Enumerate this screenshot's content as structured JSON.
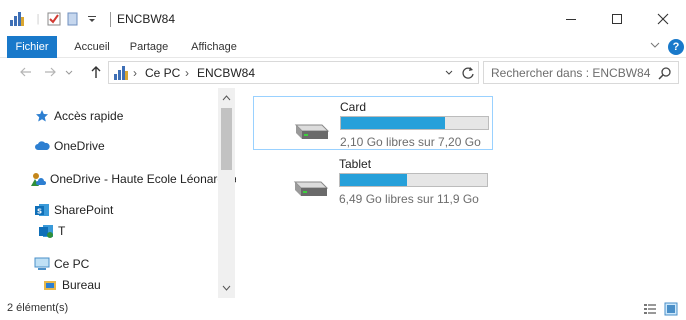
{
  "window": {
    "title": "ENCBW84",
    "controls": [
      "minimize",
      "maximize",
      "close"
    ]
  },
  "ribbon": {
    "tabs": [
      {
        "label": "Fichier",
        "active": true
      },
      {
        "label": "Accueil"
      },
      {
        "label": "Partage"
      },
      {
        "label": "Affichage"
      }
    ]
  },
  "address": {
    "segments": [
      "Ce PC",
      "ENCBW84"
    ],
    "search_placeholder": "Rechercher dans : ENCBW84"
  },
  "nav": {
    "items": [
      {
        "label": "Accès rapide",
        "icon": "star-icon"
      },
      {
        "label": "OneDrive",
        "icon": "cloud-icon"
      },
      {
        "label": "OneDrive - Haute Ecole Léonard de Vinci",
        "icon": "person-cloud-icon"
      },
      {
        "label": "SharePoint",
        "icon": "sharepoint-icon"
      },
      {
        "label": "T",
        "icon": "sharepoint-site-icon"
      },
      {
        "label": "Ce PC",
        "icon": "computer-icon"
      },
      {
        "label": "Bureau",
        "icon": "desktop-folder-icon"
      }
    ]
  },
  "drives": [
    {
      "name": "Card",
      "info": "2,10 Go libres sur 7,20 Go",
      "used_fraction": 0.708,
      "selected": true
    },
    {
      "name": "Tablet",
      "info": "6,49 Go libres sur 11,9 Go",
      "used_fraction": 0.455,
      "selected": false
    }
  ],
  "status": {
    "count": "2 élément(s)"
  },
  "colors": {
    "accent": "#1979ca",
    "bar_fill": "#26a0da",
    "selection_border": "#99d1ff"
  }
}
